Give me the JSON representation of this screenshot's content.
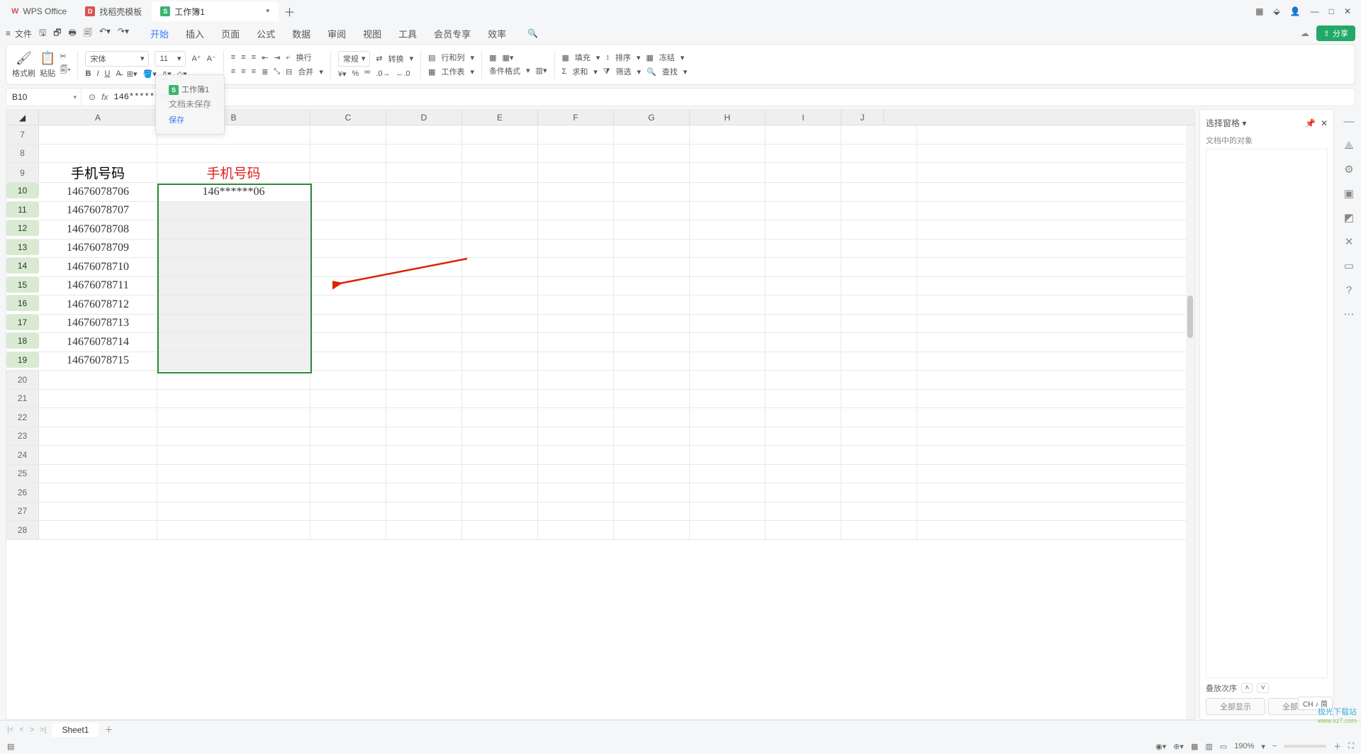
{
  "title": {
    "app": "WPS Office",
    "template": "找稻壳模板",
    "workbook": "工作簿1"
  },
  "menubar": {
    "file": "文件",
    "tabs": [
      "开始",
      "插入",
      "页面",
      "公式",
      "数据",
      "审阅",
      "视图",
      "工具",
      "会员专享",
      "效率"
    ]
  },
  "ribbon": {
    "format_painter": "格式刷",
    "paste": "粘贴",
    "font_name": "宋体",
    "font_size": "11",
    "wrap": "换行",
    "merge": "合并",
    "number_format": "常规",
    "convert": "转换",
    "rowcol": "行和列",
    "worksheet": "工作表",
    "cond_format": "条件格式",
    "sum": "求和",
    "fill": "填充",
    "sort": "排序",
    "filter": "筛选",
    "freeze": "冻结",
    "find": "查找"
  },
  "tooltip": {
    "tab": "工作簿1",
    "text": "文档未保存",
    "save": "保存"
  },
  "share": "分享",
  "namebox": "B10",
  "formula": "146******06",
  "cols": [
    "A",
    "B",
    "C",
    "D",
    "E",
    "F",
    "G",
    "H",
    "I",
    "J"
  ],
  "startRow": 7,
  "rows": [
    7,
    8,
    9,
    10,
    11,
    12,
    13,
    14,
    15,
    16,
    17,
    18,
    19,
    20,
    21,
    22,
    23,
    24,
    25,
    26,
    27,
    28
  ],
  "headers": {
    "a": "手机号码",
    "b": "手机号码"
  },
  "colA": [
    "14676078706",
    "14676078707",
    "14676078708",
    "14676078709",
    "14676078710",
    "14676078711",
    "14676078712",
    "14676078713",
    "14676078714",
    "14676078715"
  ],
  "colB_first": "146******06",
  "sidepane": {
    "title": "选择窗格",
    "sub": "文档中的对象",
    "stack": "叠放次序",
    "show_all": "全部显示",
    "hide_all": "全部隐藏"
  },
  "sheet": "Sheet1",
  "zoom": "190%",
  "ime": "CH ♪ 简",
  "watermark": {
    "a": "极光下载站",
    "b": "www.xz7.com"
  }
}
